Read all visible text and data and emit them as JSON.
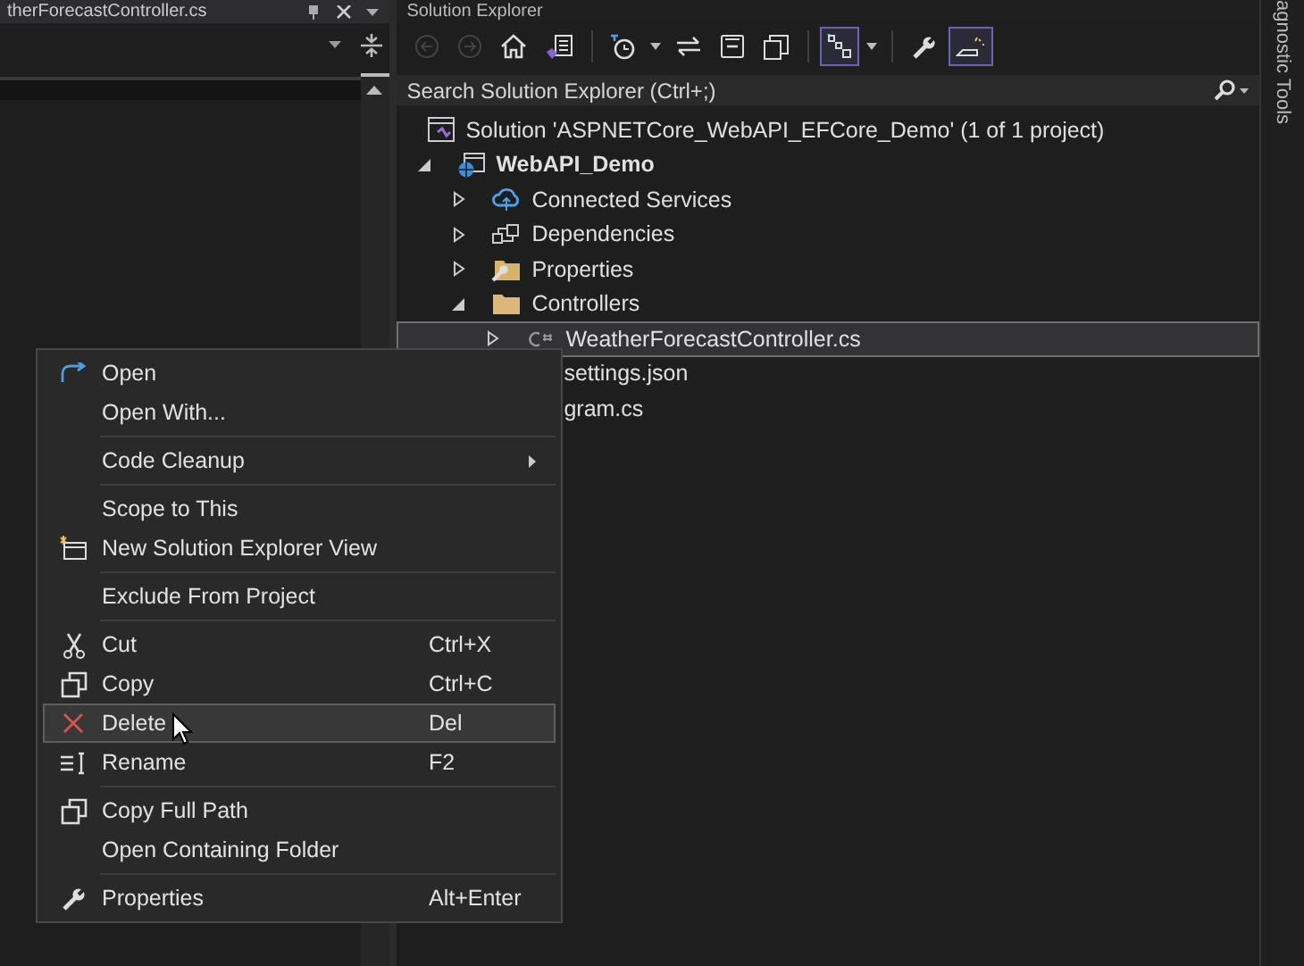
{
  "editor": {
    "tab_title": "therForecastController.cs"
  },
  "solution_explorer": {
    "title": "Solution Explorer",
    "toolbar": [
      {
        "kind": "back",
        "disabled": true,
        "selected": false
      },
      {
        "kind": "forward",
        "disabled": true,
        "selected": false
      },
      {
        "kind": "home",
        "disabled": false,
        "selected": false
      },
      {
        "kind": "switch-views",
        "disabled": false,
        "selected": false
      },
      {
        "kind": "separator"
      },
      {
        "kind": "pending-changes",
        "disabled": false,
        "selected": false
      },
      {
        "kind": "dropdown",
        "disabled": false,
        "selected": false
      },
      {
        "kind": "sync",
        "disabled": false,
        "selected": false
      },
      {
        "kind": "collapse",
        "disabled": false,
        "selected": false
      },
      {
        "kind": "show-all",
        "disabled": false,
        "selected": false
      },
      {
        "kind": "separator"
      },
      {
        "kind": "filter",
        "disabled": false,
        "selected": true
      },
      {
        "kind": "dropdown",
        "disabled": false,
        "selected": false
      },
      {
        "kind": "separator"
      },
      {
        "kind": "properties",
        "disabled": false,
        "selected": false
      },
      {
        "kind": "preview",
        "disabled": false,
        "selected": true
      }
    ],
    "search": {
      "placeholder": "Search Solution Explorer (Ctrl+;)"
    },
    "tree": [
      {
        "kind": "solution",
        "label": "Solution 'ASPNETCore_WebAPI_EFCore_Demo' (1 of 1 project)",
        "selected": false,
        "children": [
          {
            "kind": "project",
            "label": "WebAPI_Demo",
            "selected": false,
            "expanded": true,
            "children": [
              {
                "kind": "service",
                "label": "Connected Services",
                "selected": false,
                "expanded": false
              },
              {
                "kind": "dependencies",
                "label": "Dependencies",
                "selected": false,
                "expanded": false
              },
              {
                "kind": "properties",
                "label": "Properties",
                "selected": false,
                "expanded": false
              },
              {
                "kind": "folder",
                "label": "Controllers",
                "selected": false,
                "expanded": true,
                "children": [
                  {
                    "kind": "csharp",
                    "label": "WeatherForecastController.cs",
                    "selected": true,
                    "expanded": false
                  }
                ]
              },
              {
                "kind": "partial",
                "label": "settings.json",
                "selected": false
              },
              {
                "kind": "partial",
                "label": "gram.cs",
                "selected": false
              }
            ]
          }
        ]
      }
    ]
  },
  "side_tab": "agnostic Tools",
  "context_menu": {
    "groups": [
      [
        {
          "label": "Open",
          "selected": false
        },
        {
          "label": "Open With...",
          "selected": false
        }
      ],
      [
        {
          "label": "Code Cleanup",
          "submenu": true,
          "selected": false
        }
      ],
      [
        {
          "label": "Scope to This",
          "selected": false
        },
        {
          "label": "New Solution Explorer View",
          "selected": false
        }
      ],
      [
        {
          "label": "Exclude From Project",
          "selected": false
        }
      ],
      [
        {
          "label": "Cut",
          "shortcut": "Ctrl+X",
          "selected": false
        },
        {
          "label": "Copy",
          "shortcut": "Ctrl+C",
          "selected": false
        },
        {
          "label": "Delete",
          "shortcut": "Del",
          "selected": true
        },
        {
          "label": "Rename",
          "shortcut": "F2",
          "selected": false
        }
      ],
      [
        {
          "label": "Copy Full Path",
          "selected": false
        },
        {
          "label": "Open Containing Folder",
          "selected": false
        }
      ],
      [
        {
          "label": "Properties",
          "shortcut": "Alt+Enter",
          "selected": false
        }
      ]
    ]
  }
}
